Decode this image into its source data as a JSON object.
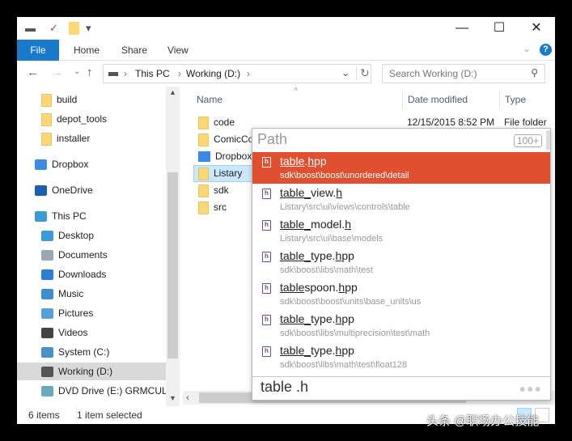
{
  "window": {
    "quick_access": {
      "drive_icon": "drive-icon",
      "properties_icon": "properties-icon",
      "new_folder_icon": "folder-icon",
      "customize_icon": "dropdown-icon"
    },
    "controls": {
      "minimize": "—",
      "maximize": "☐",
      "close": "✕"
    }
  },
  "ribbon": {
    "tabs": [
      "File",
      "Home",
      "Share",
      "View"
    ],
    "expand": "⌄",
    "help": "?"
  },
  "address": {
    "back": "←",
    "forward": "→",
    "recent": "⌄",
    "up": "↑",
    "crumbs": [
      "This PC",
      "Working (D:)"
    ],
    "sep": "›",
    "dropdown": "⌄",
    "refresh": "↻"
  },
  "search": {
    "placeholder": "Search Working (D:)",
    "icon": "⚲"
  },
  "nav": [
    {
      "label": "build",
      "icon": "folder"
    },
    {
      "label": "depot_tools",
      "icon": "folder"
    },
    {
      "label": "installer",
      "icon": "folder"
    },
    {
      "label": "Dropbox",
      "icon": "dropbox"
    },
    {
      "label": "OneDrive",
      "icon": "onedrive"
    },
    {
      "label": "This PC",
      "icon": "computer"
    },
    {
      "label": "Desktop",
      "icon": "desktop"
    },
    {
      "label": "Documents",
      "icon": "documents"
    },
    {
      "label": "Downloads",
      "icon": "downloads"
    },
    {
      "label": "Music",
      "icon": "music"
    },
    {
      "label": "Pictures",
      "icon": "pictures"
    },
    {
      "label": "Videos",
      "icon": "videos"
    },
    {
      "label": "System (C:)",
      "icon": "system-drive"
    },
    {
      "label": "Working (D:)",
      "icon": "drive",
      "selected": true
    },
    {
      "label": "DVD Drive (E:) GRMCULX",
      "icon": "dvd"
    }
  ],
  "columns": {
    "name": "Name",
    "date": "Date modified",
    "type": "Type"
  },
  "files": [
    {
      "name": "code",
      "date": "12/15/2015 8:52 PM",
      "type": "File folder",
      "icon": "folder"
    },
    {
      "name": "ComicCo",
      "icon": "folder"
    },
    {
      "name": "Dropbox",
      "icon": "dropbox"
    },
    {
      "name": "Listary",
      "icon": "folder",
      "selected": true
    },
    {
      "name": "sdk",
      "icon": "folder"
    },
    {
      "name": "src",
      "icon": "folder"
    }
  ],
  "status": {
    "items": "6 items",
    "selected": "1 item selected"
  },
  "popup": {
    "title": "Path",
    "count": "100+",
    "query": "table .h",
    "more": "●●●",
    "results": [
      {
        "parts": [
          [
            "table",
            true
          ],
          [
            ".",
            false
          ],
          [
            "h",
            true
          ],
          [
            "pp",
            false
          ]
        ],
        "path": "sdk\\boost\\boost\\unordered\\detail",
        "highlighted": true
      },
      {
        "parts": [
          [
            "table_",
            true
          ],
          [
            "view.",
            false
          ],
          [
            "h",
            true
          ]
        ],
        "path": "Listary\\src\\ui\\views\\controls\\table"
      },
      {
        "parts": [
          [
            "table_",
            true
          ],
          [
            "model.",
            false
          ],
          [
            "h",
            true
          ]
        ],
        "path": "Listary\\src\\ui\\base\\models"
      },
      {
        "parts": [
          [
            "table_",
            true
          ],
          [
            "type.",
            false
          ],
          [
            "h",
            true
          ],
          [
            "pp",
            false
          ]
        ],
        "path": "sdk\\boost\\libs\\math\\test"
      },
      {
        "parts": [
          [
            "table",
            true
          ],
          [
            "spoon.",
            false
          ],
          [
            "h",
            true
          ],
          [
            "pp",
            false
          ]
        ],
        "path": "sdk\\boost\\boost\\units\\base_units\\us"
      },
      {
        "parts": [
          [
            "table_",
            true
          ],
          [
            "type.",
            false
          ],
          [
            "h",
            true
          ],
          [
            "pp",
            false
          ]
        ],
        "path": "sdk\\boost\\libs\\multiprecision\\test\\math"
      },
      {
        "parts": [
          [
            "table_",
            true
          ],
          [
            "type.",
            false
          ],
          [
            "h",
            true
          ],
          [
            "pp",
            false
          ]
        ],
        "path": "sdk\\boost\\libs\\math\\test\\float128"
      }
    ]
  },
  "watermark": "头条 @职场办公技能",
  "colors": {
    "accent": "#1979ca",
    "highlight": "#e04f2f",
    "selection": "#cce8ff"
  }
}
